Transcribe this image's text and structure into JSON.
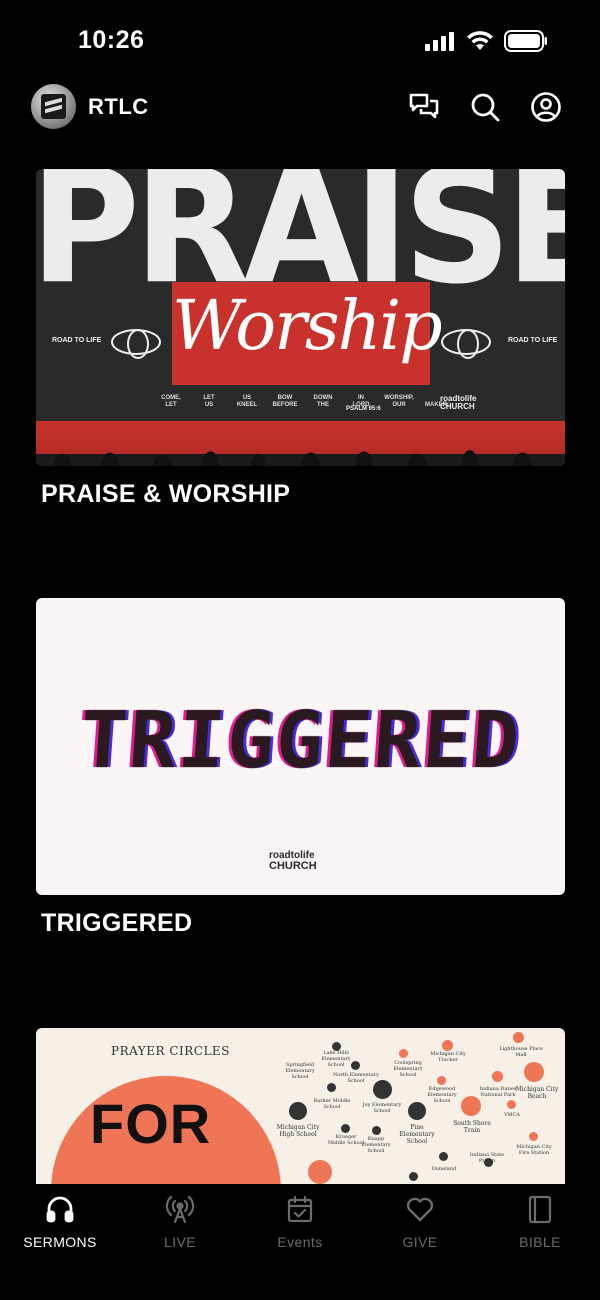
{
  "status_bar": {
    "time": "10:26"
  },
  "header": {
    "app_name": "RTLC"
  },
  "feed": [
    {
      "title": "PRAISE & WORSHIP",
      "art": {
        "headline": "PRAISE &",
        "script": "Worship",
        "side_label": "ROAD TO LIFE",
        "verse_words": [
          "COME,",
          "LET",
          "US",
          "BOW",
          "DOWN",
          "IN",
          "WORSHIP,",
          "",
          "LET",
          "US",
          "KNEEL",
          "BEFORE",
          "THE",
          "LORD",
          "OUR",
          "MAKER;"
        ],
        "verse_ref": "PSALM 95:6",
        "logo_top": "roadtolife",
        "logo_bottom": "CHURCH"
      }
    },
    {
      "title": "TRIGGERED",
      "art": {
        "headline": "TRIGGERED",
        "logo_top": "roadtolife",
        "logo_bottom": "CHURCH"
      }
    },
    {
      "title": "",
      "art": {
        "heading": "PRAYER CIRCLES",
        "big_text": "FOR",
        "map_labels": [
          "Lake Hills Elementary School",
          "Springfield Elementary School",
          "North Elementary School",
          "Coolspring Elementary School",
          "Michigan City Tracker",
          "Lighthouse Place Mall",
          "Barker Middle School",
          "Joy Elementary School",
          "Edgewood Elementary School",
          "Indiana Dunes National Park",
          "Michigan City Beach",
          "Michigan City High School",
          "Krueger Middle School",
          "Knapp Elementary School",
          "Pine Elementary School",
          "South Shore Train",
          "YMCA",
          "Michigan City Fire Station",
          "Duneland",
          "Indiana State Prison"
        ]
      }
    }
  ],
  "tabs": [
    {
      "label": "SERMONS",
      "icon": "headphones-icon",
      "active": true
    },
    {
      "label": "LIVE",
      "icon": "broadcast-icon",
      "active": false
    },
    {
      "label": "Events",
      "icon": "calendar-icon",
      "active": false
    },
    {
      "label": "GIVE",
      "icon": "heart-icon",
      "active": false
    },
    {
      "label": "BIBLE",
      "icon": "book-icon",
      "active": false
    }
  ],
  "colors": {
    "background": "#000000",
    "accent_red": "#c9322c",
    "tab_inactive": "#6b6b6b",
    "tab_active": "#ffffff"
  }
}
